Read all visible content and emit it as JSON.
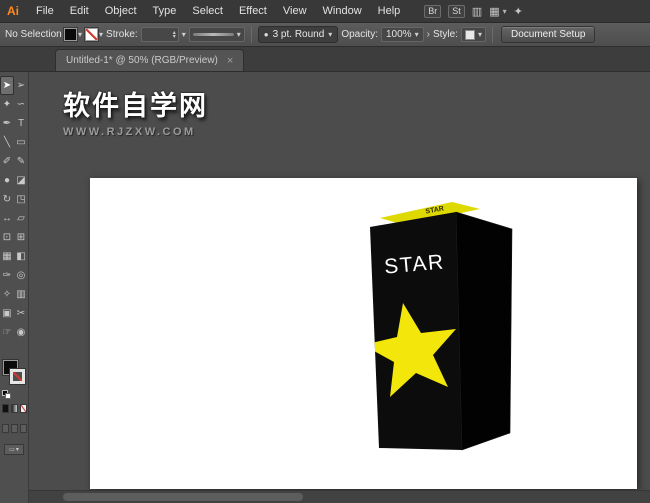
{
  "colors": {
    "accent_orange": "#ff8a1d",
    "star_yellow": "#f2e60a",
    "box_black": "#0c0c0c",
    "ui_chrome": "#4e4e4e",
    "artboard_white": "#ffffff"
  },
  "icons": {
    "chevron_down": "▾",
    "spin_up": "▴",
    "spin_down": "▾",
    "close": "×",
    "flyout": "›",
    "brush_dot": "●",
    "gpu": "▥",
    "arrange_documents": "▦",
    "workspace": "✦",
    "screen_mode": "▭"
  },
  "menu_bar": {
    "logo": "Ai",
    "items": [
      "File",
      "Edit",
      "Object",
      "Type",
      "Select",
      "Effect",
      "View",
      "Window",
      "Help"
    ],
    "bridge_label": "Br",
    "stock_label": "St"
  },
  "control_bar": {
    "selection_status": "No Selection",
    "stroke_label": "Stroke:",
    "brush_name": "3 pt. Round",
    "opacity_label": "Opacity:",
    "opacity_value": "100%",
    "style_label": "Style:",
    "document_setup_label": "Document Setup"
  },
  "tabs": [
    {
      "title": "Untitled-1* @ 50% (RGB/Preview)"
    }
  ],
  "toolbar": {
    "tools": [
      {
        "name": "selection",
        "glyph": "➤",
        "selected": true
      },
      {
        "name": "direct-selection",
        "glyph": "➢",
        "selected": false
      },
      {
        "name": "magic-wand",
        "glyph": "✦",
        "selected": false
      },
      {
        "name": "lasso",
        "glyph": "∽",
        "selected": false
      },
      {
        "name": "pen",
        "glyph": "✒",
        "selected": false
      },
      {
        "name": "type",
        "glyph": "T",
        "selected": false
      },
      {
        "name": "line-segment",
        "glyph": "╲",
        "selected": false
      },
      {
        "name": "rectangle",
        "glyph": "▭",
        "selected": false
      },
      {
        "name": "paintbrush",
        "glyph": "✐",
        "selected": false
      },
      {
        "name": "pencil",
        "glyph": "✎",
        "selected": false
      },
      {
        "name": "blob-brush",
        "glyph": "●",
        "selected": false
      },
      {
        "name": "eraser",
        "glyph": "◪",
        "selected": false
      },
      {
        "name": "rotate",
        "glyph": "↻",
        "selected": false
      },
      {
        "name": "scale",
        "glyph": "◳",
        "selected": false
      },
      {
        "name": "width",
        "glyph": "↔",
        "selected": false
      },
      {
        "name": "free-transform",
        "glyph": "▱",
        "selected": false
      },
      {
        "name": "shape-builder",
        "glyph": "⊡",
        "selected": false
      },
      {
        "name": "perspective-grid",
        "glyph": "⊞",
        "selected": false
      },
      {
        "name": "mesh",
        "glyph": "▦",
        "selected": false
      },
      {
        "name": "gradient",
        "glyph": "◧",
        "selected": false
      },
      {
        "name": "eyedropper",
        "glyph": "✑",
        "selected": false
      },
      {
        "name": "blend",
        "glyph": "◎",
        "selected": false
      },
      {
        "name": "symbol-sprayer",
        "glyph": "✧",
        "selected": false
      },
      {
        "name": "column-graph",
        "glyph": "▥",
        "selected": false
      },
      {
        "name": "artboard",
        "glyph": "▣",
        "selected": false
      },
      {
        "name": "slice",
        "glyph": "✂",
        "selected": false
      },
      {
        "name": "hand",
        "glyph": "☞",
        "selected": false
      },
      {
        "name": "zoom",
        "glyph": "◉",
        "selected": false
      }
    ]
  },
  "watermark": {
    "title": "软件自学网",
    "subtitle": "WWW.RJZXW.COM"
  },
  "artboard": {
    "box": {
      "front_text": "STAR",
      "top_text": "STAR"
    }
  }
}
